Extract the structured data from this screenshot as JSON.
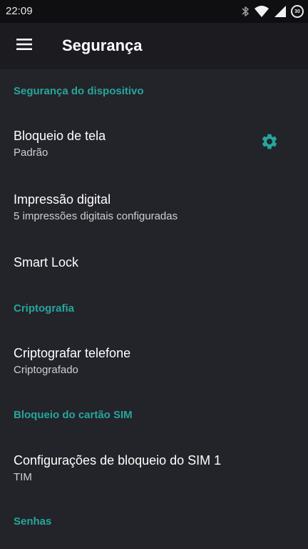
{
  "status_bar": {
    "time": "22:09",
    "battery_level": "30",
    "icons": [
      "bluetooth-icon",
      "wifi-icon",
      "signal-icon",
      "battery-icon"
    ]
  },
  "app_bar": {
    "title": "Segurança",
    "menu_icon": "menu-icon"
  },
  "sections": {
    "device_security": {
      "header": "Segurança do dispositivo",
      "screen_lock": {
        "title": "Bloqueio de tela",
        "subtitle": "Padrão",
        "settings_icon": "gear-icon"
      },
      "fingerprint": {
        "title": "Impressão digital",
        "subtitle": "5 impressões digitais configuradas"
      },
      "smart_lock": {
        "title": "Smart Lock"
      }
    },
    "encryption": {
      "header": "Criptografia",
      "encrypt_phone": {
        "title": "Criptografar telefone",
        "subtitle": "Criptografado"
      }
    },
    "sim_lock": {
      "header": "Bloqueio do cartão SIM",
      "sim1": {
        "title": "Configurações de bloqueio do SIM 1",
        "subtitle": "TIM"
      }
    },
    "passwords": {
      "header": "Senhas"
    }
  },
  "colors": {
    "accent": "#26a69a",
    "background": "#23232a",
    "app_bar": "#1b1b20",
    "status_bar": "#0f0f12"
  }
}
